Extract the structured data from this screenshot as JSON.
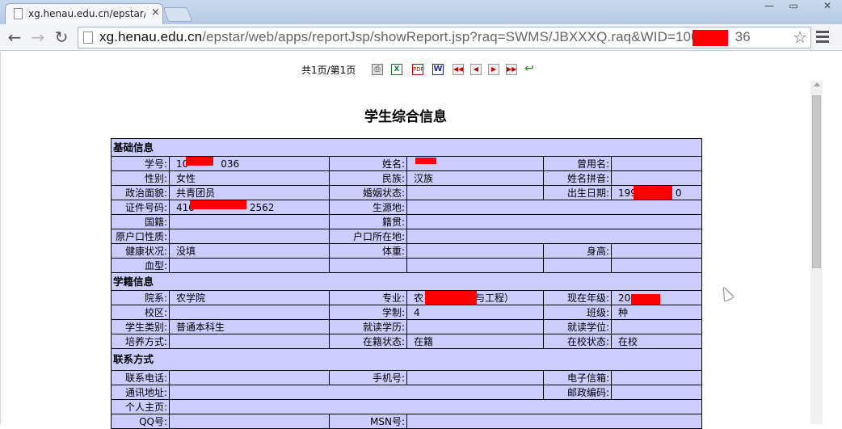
{
  "browser": {
    "tab_title": "xg.henau.edu.cn/epstar/",
    "tab_close": "×",
    "url_host": "xg.henau.edu.cn",
    "url_path": "/epstar/web/apps/reportJsp/showReport.jsp?raq=SWMS/JBXXXQ.raq&WID=100",
    "url_tail": "36",
    "back": "←",
    "forward": "→",
    "reload": "↻",
    "star": "☆",
    "minimize": "—",
    "maximize": "▭",
    "close": "✕"
  },
  "report_toolbar": {
    "pager": "共1页/第1页",
    "icons": [
      "print-icon",
      "excel-icon",
      "pdf-icon",
      "word-icon",
      "first-page-icon",
      "prev-page-icon",
      "next-page-icon",
      "last-page-icon",
      "return-icon"
    ],
    "print_glyph": "⎙",
    "excel_glyph": "X",
    "pdf_glyph": "PDF",
    "word_glyph": "W",
    "first_glyph": "◀◀",
    "prev_glyph": "◀",
    "next_glyph": "▶",
    "last_glyph": "▶▶",
    "return_glyph": "↩"
  },
  "report": {
    "title": "学生综合信息",
    "sections": {
      "basic": "基础信息",
      "enroll": "学籍信息",
      "contact": "联系方式"
    },
    "basic": {
      "r1": [
        "学号:",
        "10",
        "036",
        "姓名:",
        "",
        "曾用名:",
        ""
      ],
      "r2": [
        "性别:",
        "女性",
        "民族:",
        "汉族",
        "姓名拼音:",
        ""
      ],
      "r3": [
        "政治面貌:",
        "共青团员",
        "婚姻状态:",
        "",
        "出生日期:",
        "199",
        "0"
      ],
      "r4": [
        "证件号码:",
        "410",
        "2562",
        "生源地:",
        ""
      ],
      "r5": [
        "国籍:",
        "",
        "籍贯:",
        ""
      ],
      "r6": [
        "原户口性质:",
        "",
        "户口所在地:",
        ""
      ],
      "r7": [
        "健康状况:",
        "没填",
        "体重:",
        "",
        "身高:",
        ""
      ],
      "r8": [
        "血型:",
        "",
        "",
        "",
        "",
        ""
      ]
    },
    "enroll": {
      "r1": [
        "院系:",
        "农学院",
        "专业:",
        "农",
        "与工程）",
        "现在年级:",
        "20"
      ],
      "r2": [
        "校区:",
        "",
        "学制:",
        "4",
        "班级:",
        "种"
      ],
      "r3": [
        "学生类别:",
        "普通本科生",
        "就读学历:",
        "",
        "就读学位:",
        ""
      ],
      "r4": [
        "培养方式:",
        "",
        "在籍状态:",
        "在籍",
        "在校状态:",
        "在校"
      ]
    },
    "contact": {
      "r1": [
        "联系电话:",
        "",
        "手机号:",
        "",
        "电子信箱:",
        ""
      ],
      "r2": [
        "通讯地址:",
        "",
        "邮政编码:",
        ""
      ],
      "r3": [
        "个人主页:",
        ""
      ],
      "r4": [
        "QQ号:",
        "",
        "MSN号:",
        ""
      ]
    }
  },
  "colors": {
    "table_bg": "#ccccff",
    "redaction": "#ff0000"
  }
}
